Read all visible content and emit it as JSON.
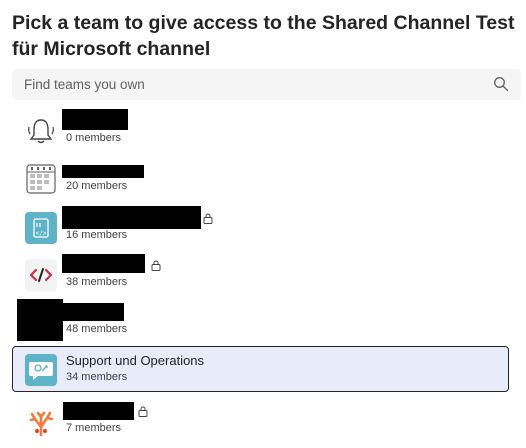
{
  "dialog": {
    "title": "Pick a team to give access to the Shared Channel Test für Microsoft channel"
  },
  "search": {
    "placeholder": "Find teams you own",
    "icon": "search-icon"
  },
  "teams": [
    {
      "name": "",
      "members": "0 members",
      "icon": "bell-icon",
      "private": false,
      "selected": false
    },
    {
      "name": "",
      "members": "20 members",
      "icon": "calendar-grid-icon",
      "private": false,
      "selected": false
    },
    {
      "name": "",
      "members": "16 members",
      "icon": "code-document-icon",
      "private": true,
      "selected": false
    },
    {
      "name": "",
      "members": "38 members",
      "icon": "code-brackets-icon",
      "private": true,
      "selected": false
    },
    {
      "name": "",
      "members": "48 members",
      "icon": "",
      "private": false,
      "selected": false
    },
    {
      "name": "Support und Operations",
      "members": "34 members",
      "icon": "support-chat-icon",
      "private": false,
      "selected": true
    },
    {
      "name": "",
      "members": "7 members",
      "icon": "coral-icon",
      "private": true,
      "selected": false
    }
  ],
  "colors": {
    "selected_bg": "#e8ebfa",
    "accent_teal": "#5fb3c9",
    "code_red": "#c4314b"
  }
}
